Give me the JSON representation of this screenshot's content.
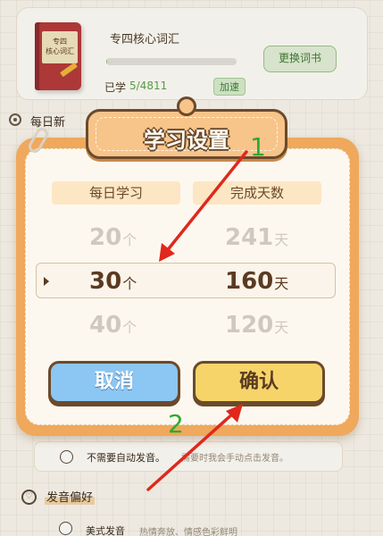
{
  "book": {
    "cover_text": "专四\n核心词汇",
    "title": "专四核心词汇",
    "learned_label": "已学",
    "learned_count": "5/4811",
    "progress": 0.001,
    "speed_badge": "加速",
    "change_button": "更换词书"
  },
  "daily_new": "每日新",
  "dialog": {
    "title": "学习设置",
    "col_daily": "每日学习",
    "col_days": "完成天数",
    "rows": [
      {
        "count": "20",
        "count_unit": "个",
        "days": "241",
        "days_unit": "天"
      },
      {
        "count": "30",
        "count_unit": "个",
        "days": "160",
        "days_unit": "天"
      },
      {
        "count": "40",
        "count_unit": "个",
        "days": "120",
        "days_unit": "天"
      }
    ],
    "selected_index": 1,
    "cancel_label": "取消",
    "confirm_label": "确认"
  },
  "auto_pronounce": {
    "label": "不需要自动发音。",
    "hint": "需要时我会手动点击发音。"
  },
  "pronounce_pref": {
    "title": "发音偏好",
    "accent_label": "美式发音",
    "accent_hint": "热情奔放、情感色彩鲜明"
  },
  "annotations": {
    "label_1": "1",
    "label_2": "2",
    "arrow_color": "#e0281c",
    "label_color": "#2ea92e"
  }
}
